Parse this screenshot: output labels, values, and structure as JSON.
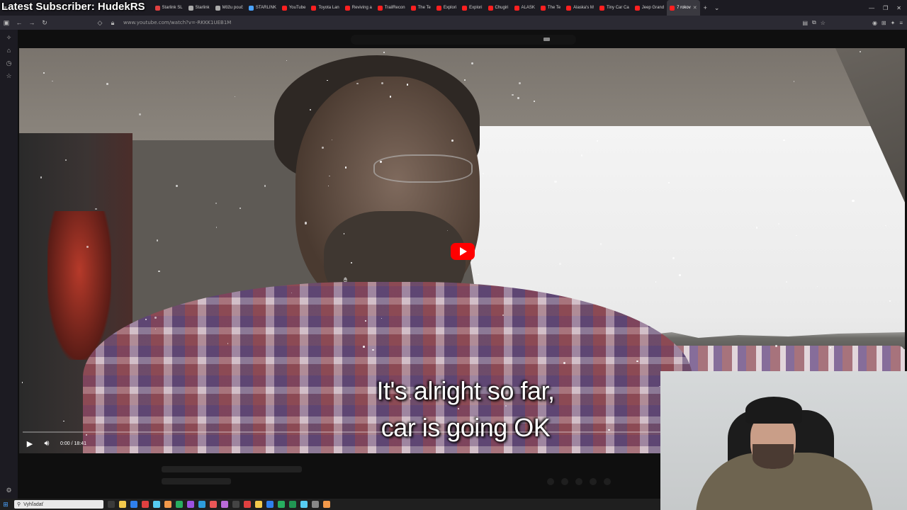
{
  "overlay": {
    "title": "Latest Subscriber: HudekRS"
  },
  "tabs": [
    {
      "label": "Starlink SL",
      "color": "#e04040"
    },
    {
      "label": "Starlink",
      "color": "#aaaaaa"
    },
    {
      "label": "Môžu pouč",
      "color": "#aaaaaa"
    },
    {
      "label": "STARLINK",
      "color": "#4aa3ff"
    },
    {
      "label": "YouTube",
      "color": "#ff2020"
    },
    {
      "label": "Toyota Lan",
      "color": "#ff2020"
    },
    {
      "label": "Reviving a",
      "color": "#ff2020"
    },
    {
      "label": "TrailRecon",
      "color": "#ff2020"
    },
    {
      "label": "The Te",
      "color": "#ff2020"
    },
    {
      "label": "Explori",
      "color": "#ff2020"
    },
    {
      "label": "Explori",
      "color": "#ff2020"
    },
    {
      "label": "Chugiri",
      "color": "#ff2020"
    },
    {
      "label": "ALASK",
      "color": "#ff2020"
    },
    {
      "label": "The Te",
      "color": "#ff2020"
    },
    {
      "label": "Alaska's M",
      "color": "#ff2020"
    },
    {
      "label": "Tiny Car Ca",
      "color": "#ff2020"
    },
    {
      "label": "Jeep Grand",
      "color": "#ff2020"
    },
    {
      "label": "7 rokov",
      "color": "#ff2020",
      "active": true
    }
  ],
  "browser": {
    "url": "www.youtube.com/watch?v=-RKKK1UEB1M"
  },
  "video": {
    "subtitle_line1": "It's alright so far,",
    "subtitle_line2": "car is going OK",
    "time": "0:00 / 18:41",
    "progress": 0
  },
  "taskbar": {
    "search_placeholder": "Vyhľadať"
  }
}
